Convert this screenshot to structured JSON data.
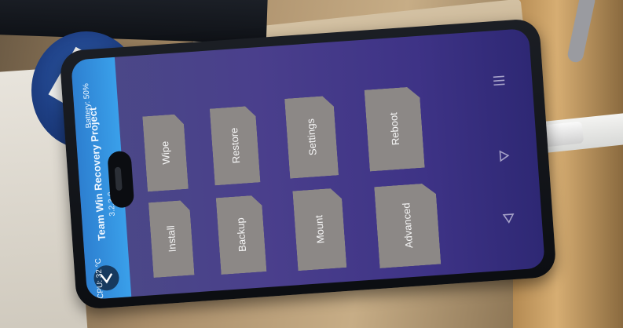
{
  "twrp": {
    "header": {
      "title": "Team Win Recovery Project",
      "version": "3.2.3-0",
      "cpu": "CPU: 32 °C",
      "battery": "Battery: 50%"
    },
    "buttons": {
      "install": "Install",
      "wipe": "Wipe",
      "backup": "Backup",
      "restore": "Restore",
      "mount": "Mount",
      "settings": "Settings",
      "advanced": "Advanced",
      "reboot": "Reboot"
    },
    "nav_icons": [
      "menu-icon",
      "home-icon",
      "back-icon"
    ],
    "colors": {
      "header_blue": "#3a9fe9",
      "screen_purple": "#4a3f8c",
      "tile_gray": "#8c8886"
    }
  }
}
